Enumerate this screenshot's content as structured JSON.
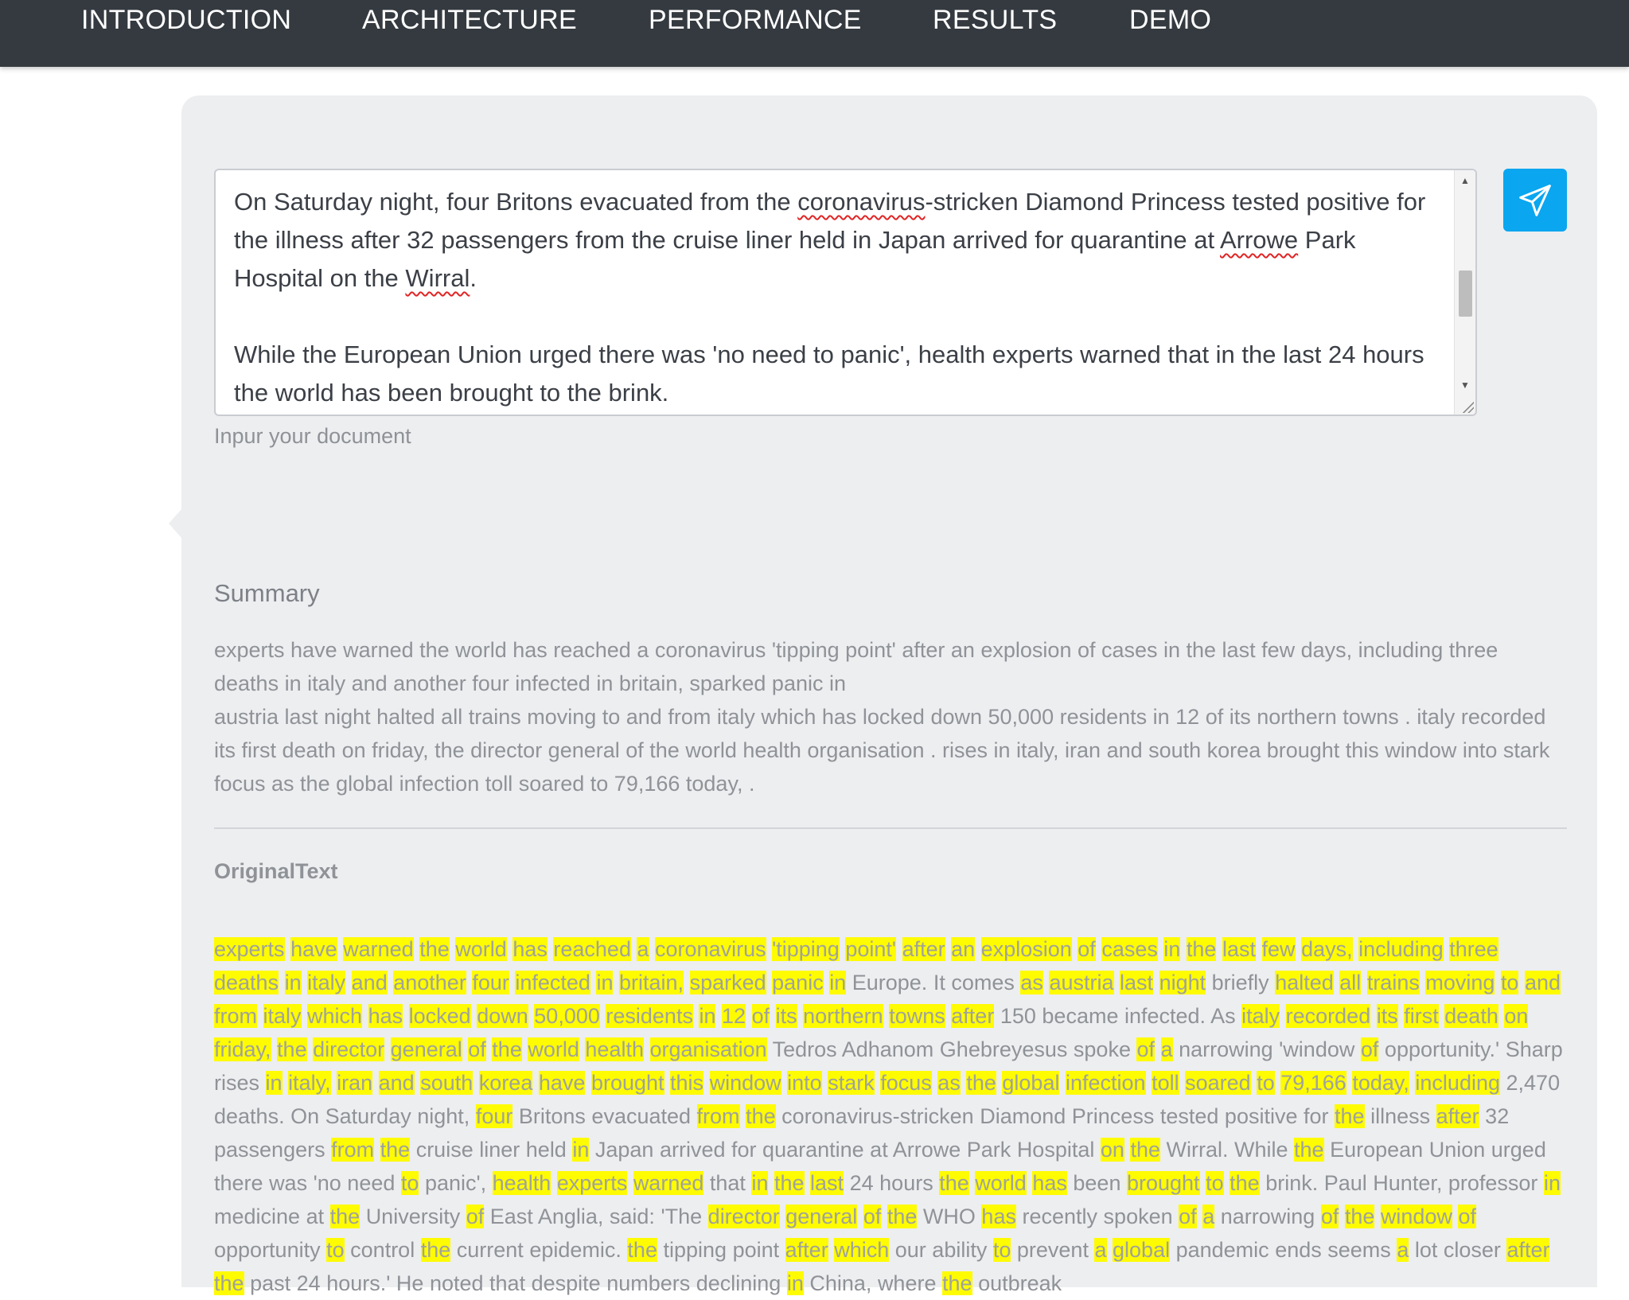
{
  "nav": {
    "items": [
      {
        "label": "INTRODUCTION"
      },
      {
        "label": "ARCHITECTURE"
      },
      {
        "label": "PERFORMANCE"
      },
      {
        "label": "RESULTS"
      },
      {
        "label": "DEMO"
      }
    ]
  },
  "input": {
    "paragraph1": {
      "t1": "On Saturday night, four Britons evacuated from the ",
      "s1": "coronavirus",
      "t2": "-stricken Diamond Princess tested positive for the illness after 32 passengers from the cruise liner held in Japan arrived for quarantine at ",
      "s2": "Arrowe",
      "t3": " Park Hospital on the ",
      "s3": "Wirral",
      "t4": "."
    },
    "paragraph2": "While the European Union urged there was 'no need to panic', health experts warned that in the last 24 hours the world has been brought to the brink.",
    "helper": "Inpur your document"
  },
  "summary": {
    "title": "Summary",
    "line1": "experts have warned the world has reached a coronavirus 'tipping point' after an explosion of cases in the last few days, including three deaths in italy and another four infected in britain, sparked panic in",
    "line2": "austria last night halted all trains moving to and from italy which has locked down 50,000 residents in 12 of its northern towns . italy recorded its first death on friday, the director general of the world health organisation . rises in italy, iran and south korea brought this window into stark focus as the global infection toll soared to 79,166 today, ."
  },
  "original": {
    "title": "OriginalText",
    "tokens": [
      [
        "experts",
        1
      ],
      [
        "have",
        1
      ],
      [
        "warned",
        1
      ],
      [
        "the",
        1
      ],
      [
        "world",
        1
      ],
      [
        "has",
        1
      ],
      [
        "reached",
        1
      ],
      [
        "a",
        1
      ],
      [
        "coronavirus",
        1
      ],
      [
        "'tipping",
        1
      ],
      [
        "point'",
        1
      ],
      [
        "after",
        1
      ],
      [
        "an",
        1
      ],
      [
        "explosion",
        1
      ],
      [
        "of",
        1
      ],
      [
        "cases",
        1
      ],
      [
        "in",
        1
      ],
      [
        "the",
        1
      ],
      [
        "last",
        1
      ],
      [
        "few",
        1
      ],
      [
        "days,",
        1
      ],
      [
        "including",
        1
      ],
      [
        "three",
        1
      ],
      [
        "deaths",
        1
      ],
      [
        "in",
        1
      ],
      [
        "italy",
        1
      ],
      [
        "and",
        1
      ],
      [
        "another",
        1
      ],
      [
        "four",
        1
      ],
      [
        "infected",
        1
      ],
      [
        "in",
        1
      ],
      [
        "britain,",
        1
      ],
      [
        "sparked",
        1
      ],
      [
        "panic",
        1
      ],
      [
        "in",
        1
      ],
      [
        "Europe.",
        0
      ],
      [
        "It",
        0
      ],
      [
        "comes",
        0
      ],
      [
        "as",
        1
      ],
      [
        "austria",
        1
      ],
      [
        "last",
        1
      ],
      [
        "night",
        1
      ],
      [
        "briefly",
        0
      ],
      [
        "halted",
        1
      ],
      [
        "all",
        1
      ],
      [
        "trains",
        1
      ],
      [
        "moving",
        1
      ],
      [
        "to",
        1
      ],
      [
        "and",
        1
      ],
      [
        "from",
        1
      ],
      [
        "italy",
        1
      ],
      [
        "which",
        1
      ],
      [
        "has",
        1
      ],
      [
        "locked",
        1
      ],
      [
        "down",
        1
      ],
      [
        "50,000",
        1
      ],
      [
        "residents",
        1
      ],
      [
        "in",
        1
      ],
      [
        "12",
        1
      ],
      [
        "of",
        1
      ],
      [
        "its",
        1
      ],
      [
        "northern",
        1
      ],
      [
        "towns",
        1
      ],
      [
        "after",
        1
      ],
      [
        "150",
        0
      ],
      [
        "became",
        0
      ],
      [
        "infected.",
        0
      ],
      [
        "As",
        0
      ],
      [
        "italy",
        1
      ],
      [
        "recorded",
        1
      ],
      [
        "its",
        1
      ],
      [
        "first",
        1
      ],
      [
        "death",
        1
      ],
      [
        "on",
        1
      ],
      [
        "friday,",
        1
      ],
      [
        "the",
        1
      ],
      [
        "director",
        1
      ],
      [
        "general",
        1
      ],
      [
        "of",
        1
      ],
      [
        "the",
        1
      ],
      [
        "world",
        1
      ],
      [
        "health",
        1
      ],
      [
        "organisation",
        1
      ],
      [
        "Tedros",
        0
      ],
      [
        "Adhanom",
        0
      ],
      [
        "Ghebreyesus",
        0
      ],
      [
        "spoke",
        0
      ],
      [
        "of",
        1
      ],
      [
        "a",
        1
      ],
      [
        "narrowing",
        0
      ],
      [
        "'window",
        0
      ],
      [
        "of",
        1
      ],
      [
        "opportunity.'",
        0
      ],
      [
        "Sharp",
        0
      ],
      [
        "rises",
        0
      ],
      [
        "in",
        1
      ],
      [
        "italy,",
        1
      ],
      [
        "iran",
        1
      ],
      [
        "and",
        1
      ],
      [
        "south",
        1
      ],
      [
        "korea",
        1
      ],
      [
        "have",
        1
      ],
      [
        "brought",
        1
      ],
      [
        "this",
        1
      ],
      [
        "window",
        1
      ],
      [
        "into",
        1
      ],
      [
        "stark",
        1
      ],
      [
        "focus",
        1
      ],
      [
        "as",
        1
      ],
      [
        "the",
        1
      ],
      [
        "global",
        1
      ],
      [
        "infection",
        1
      ],
      [
        "toll",
        1
      ],
      [
        "soared",
        1
      ],
      [
        "to",
        1
      ],
      [
        "79,166",
        1
      ],
      [
        "today,",
        1
      ],
      [
        "including",
        1
      ],
      [
        "2,470",
        0
      ],
      [
        "deaths.",
        0
      ],
      [
        "On",
        0
      ],
      [
        "Saturday",
        0
      ],
      [
        "night,",
        0
      ],
      [
        "four",
        1
      ],
      [
        "Britons",
        0
      ],
      [
        "evacuated",
        0
      ],
      [
        "from",
        1
      ],
      [
        "the",
        1
      ],
      [
        "coronavirus-stricken",
        0
      ],
      [
        "Diamond",
        0
      ],
      [
        "Princess",
        0
      ],
      [
        "tested",
        0
      ],
      [
        "positive",
        0
      ],
      [
        "for",
        0
      ],
      [
        "the",
        1
      ],
      [
        "illness",
        0
      ],
      [
        "after",
        1
      ],
      [
        "32",
        0
      ],
      [
        "passengers",
        0
      ],
      [
        "from",
        1
      ],
      [
        "the",
        1
      ],
      [
        "cruise",
        0
      ],
      [
        "liner",
        0
      ],
      [
        "held",
        0
      ],
      [
        "in",
        1
      ],
      [
        "Japan",
        0
      ],
      [
        "arrived",
        0
      ],
      [
        "for",
        0
      ],
      [
        "quarantine",
        0
      ],
      [
        "at",
        0
      ],
      [
        "Arrowe",
        0
      ],
      [
        "Park",
        0
      ],
      [
        "Hospital",
        0
      ],
      [
        "on",
        1
      ],
      [
        "the",
        1
      ],
      [
        "Wirral.",
        0
      ],
      [
        "While",
        0
      ],
      [
        "the",
        1
      ],
      [
        "European",
        0
      ],
      [
        "Union",
        0
      ],
      [
        "urged",
        0
      ],
      [
        "there",
        0
      ],
      [
        "was",
        0
      ],
      [
        "'no",
        0
      ],
      [
        "need",
        0
      ],
      [
        "to",
        1
      ],
      [
        "panic',",
        0
      ],
      [
        "health",
        1
      ],
      [
        "experts",
        1
      ],
      [
        "warned",
        1
      ],
      [
        "that",
        0
      ],
      [
        "in",
        1
      ],
      [
        "the",
        1
      ],
      [
        "last",
        1
      ],
      [
        "24",
        0
      ],
      [
        "hours",
        0
      ],
      [
        "the",
        1
      ],
      [
        "world",
        1
      ],
      [
        "has",
        1
      ],
      [
        "been",
        0
      ],
      [
        "brought",
        1
      ],
      [
        "to",
        1
      ],
      [
        "the",
        1
      ],
      [
        "brink.",
        0
      ],
      [
        "Paul",
        0
      ],
      [
        "Hunter,",
        0
      ],
      [
        "professor",
        0
      ],
      [
        "in",
        1
      ],
      [
        "medicine",
        0
      ],
      [
        "at",
        0
      ],
      [
        "the",
        1
      ],
      [
        "University",
        0
      ],
      [
        "of",
        1
      ],
      [
        "East",
        0
      ],
      [
        "Anglia,",
        0
      ],
      [
        "said:",
        0
      ],
      [
        "'The",
        0
      ],
      [
        "director",
        1
      ],
      [
        "general",
        1
      ],
      [
        "of",
        1
      ],
      [
        "the",
        1
      ],
      [
        "WHO",
        0
      ],
      [
        "has",
        1
      ],
      [
        "recently",
        0
      ],
      [
        "spoken",
        0
      ],
      [
        "of",
        1
      ],
      [
        "a",
        1
      ],
      [
        "narrowing",
        0
      ],
      [
        "of",
        1
      ],
      [
        "the",
        1
      ],
      [
        "window",
        1
      ],
      [
        "of",
        1
      ],
      [
        "opportunity",
        0
      ],
      [
        "to",
        1
      ],
      [
        "control",
        0
      ],
      [
        "the",
        1
      ],
      [
        "current",
        0
      ],
      [
        "epidemic.",
        0
      ],
      [
        "the",
        1
      ],
      [
        "tipping",
        0
      ],
      [
        "point",
        0
      ],
      [
        "after",
        1
      ],
      [
        "which",
        1
      ],
      [
        "our",
        0
      ],
      [
        "ability",
        0
      ],
      [
        "to",
        1
      ],
      [
        "prevent",
        0
      ],
      [
        "a",
        1
      ],
      [
        "global",
        1
      ],
      [
        "pandemic",
        0
      ],
      [
        "ends",
        0
      ],
      [
        "seems",
        0
      ],
      [
        "a",
        1
      ],
      [
        "lot",
        0
      ],
      [
        "closer",
        0
      ],
      [
        "after",
        1
      ],
      [
        "the",
        1
      ],
      [
        "past",
        0
      ],
      [
        "24",
        0
      ],
      [
        "hours.'",
        0
      ],
      [
        "He",
        0
      ],
      [
        "noted",
        0
      ],
      [
        "that",
        0
      ],
      [
        "despite",
        0
      ],
      [
        "numbers",
        0
      ],
      [
        "declining",
        0
      ],
      [
        "in",
        1
      ],
      [
        "China,",
        0
      ],
      [
        "where",
        0
      ],
      [
        "the",
        1
      ],
      [
        "outbreak",
        0
      ]
    ]
  },
  "icons": {
    "send": "paper-plane-icon",
    "scroll_up": "arrow-up-icon",
    "scroll_down": "arrow-down-icon"
  },
  "colors": {
    "navbar": "#343a40",
    "send_button": "#0aa6f0",
    "highlight": "#fffb00",
    "card": "#edeef0"
  }
}
